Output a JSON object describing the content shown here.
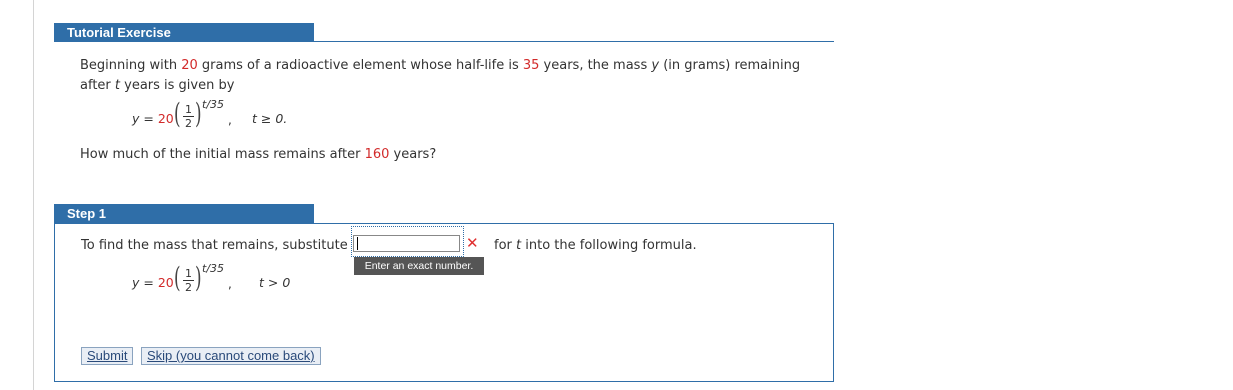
{
  "tutorial": {
    "header": "Tutorial Exercise",
    "problem": {
      "p1": "Beginning with ",
      "mass": "20",
      "p2": " grams of a radioactive element whose half-life is ",
      "half_life": "35",
      "p3": " years, the mass ",
      "y_var": "y",
      "p4": " (in grams) remaining",
      "line2_a": "after ",
      "t_var": "t",
      "line2_b": " years is given by"
    },
    "formula": {
      "y_eq": "y = ",
      "coef": "20",
      "frac_num": "1",
      "frac_den": "2",
      "exponent": "t/35",
      "comma": ",",
      "condition": "t ≥ 0."
    },
    "question": {
      "q1": "How much of the initial mass remains after ",
      "years": "160",
      "q2": " years?"
    }
  },
  "step1": {
    "header": "Step 1",
    "instruction_a": "To find the mass that remains, substitute",
    "instruction_b": "for ",
    "t_var": "t",
    "instruction_c": " into the following formula.",
    "answer_value": "",
    "answer_hint": "Enter an exact number.",
    "status_icon": "incorrect-x-icon",
    "formula": {
      "y_eq": "y = ",
      "coef": "20",
      "frac_num": "1",
      "frac_den": "2",
      "exponent": "t/35",
      "comma": ",",
      "condition": "t > 0"
    },
    "buttons": {
      "submit": "Submit",
      "skip": "Skip (you cannot come back)"
    }
  },
  "colors": {
    "header_bg": "#2f6ea8",
    "highlight": "#d22a2a",
    "error": "#e03030"
  }
}
